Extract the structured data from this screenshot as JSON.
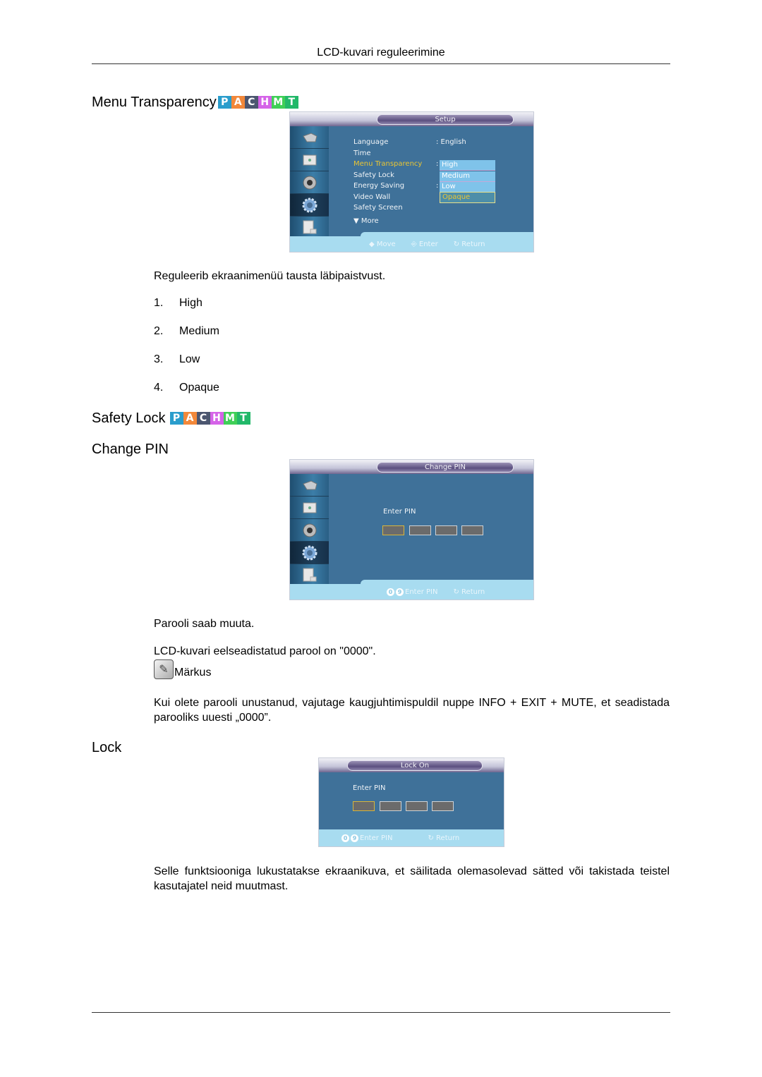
{
  "header": {
    "title": "LCD-kuvari reguleerimine"
  },
  "badge_letters": [
    {
      "letter": "P",
      "color": "#2a9dcc"
    },
    {
      "letter": "A",
      "color": "#f2883a"
    },
    {
      "letter": "C",
      "color": "#4c5670"
    },
    {
      "letter": "H",
      "color": "#d563e8"
    },
    {
      "letter": "M",
      "color": "#3fcf57"
    },
    {
      "letter": "T",
      "color": "#22b869"
    }
  ],
  "menu_transparency": {
    "heading": "Menu Transparency",
    "osd": {
      "title": "Setup",
      "sidebar_icons": [
        "input-icon",
        "picture-icon",
        "sound-icon",
        "setup-icon",
        "multi-control-icon"
      ],
      "active_sidebar_index": 3,
      "items": [
        {
          "label": "Language",
          "value": ": English"
        },
        {
          "label": "Time",
          "value": ""
        },
        {
          "label": "Menu Transparency",
          "value": ":",
          "selected": true
        },
        {
          "label": "Safety Lock",
          "value": ""
        },
        {
          "label": "Energy Saving",
          "value": ":"
        },
        {
          "label": "Video Wall",
          "value": ""
        },
        {
          "label": "Safety Screen",
          "value": ""
        },
        {
          "label": "▼ More",
          "value": ""
        }
      ],
      "dropdown": [
        "High",
        "Medium",
        "Low",
        "Opaque"
      ],
      "dropdown_focused": "Opaque",
      "footer": {
        "move": "Move",
        "enter": "Enter",
        "return": "Return"
      }
    },
    "description": "Reguleerib ekraanimenüü tausta läbipaistvust.",
    "options": [
      {
        "num": "1.",
        "label": "High"
      },
      {
        "num": "2.",
        "label": "Medium"
      },
      {
        "num": "3.",
        "label": "Low"
      },
      {
        "num": "4.",
        "label": "Opaque"
      }
    ]
  },
  "safety_lock": {
    "heading": "Safety Lock"
  },
  "change_pin": {
    "heading": "Change PIN",
    "osd": {
      "title": "Change PIN",
      "enter_pin_label": "Enter PIN",
      "footer": {
        "digit_from": "0",
        "digit_to": "9",
        "enter_pin": "Enter PIN",
        "return": "Return"
      }
    },
    "text1": "Parooli saab muuta.",
    "text2": "LCD-kuvari eelseadistatud parool on \"0000\".",
    "note_label": "Märkus",
    "note_text": "Kui olete parooli unustanud, vajutage kaugjuhtimispuldil nuppe INFO + EXIT + MUTE, et seadistada parooliks uuesti „0000”."
  },
  "lock": {
    "heading": "Lock",
    "osd": {
      "title": "Lock On",
      "enter_pin_label": "Enter PIN",
      "footer": {
        "digit_from": "0",
        "digit_to": "9",
        "enter_pin": "Enter PIN",
        "return": "Return"
      }
    },
    "description": "Selle funktsiooniga lukustatakse ekraanikuva, et säilitada olemasolevad sätted või takistada teistel kasutajatel neid muutmast."
  }
}
